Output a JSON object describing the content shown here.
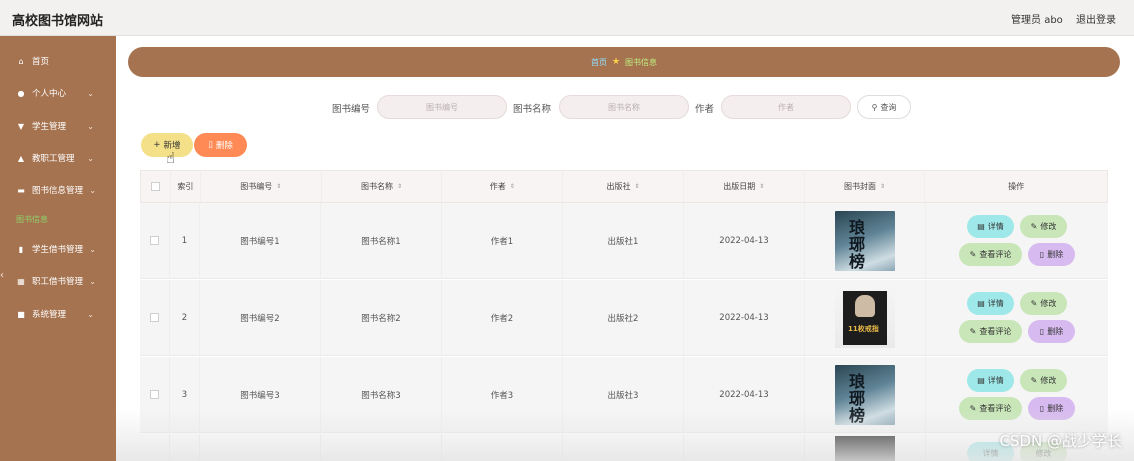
{
  "header": {
    "site_title": "高校图书馆网站",
    "admin_label": "管理员 abo",
    "logout_label": "退出登录"
  },
  "sidebar": {
    "items": [
      {
        "label": "首页",
        "icon": "home-icon"
      },
      {
        "label": "个人中心",
        "icon": "user-icon"
      },
      {
        "label": "学生管理",
        "icon": "student-icon"
      },
      {
        "label": "教职工管理",
        "icon": "staff-icon"
      },
      {
        "label": "图书信息管理",
        "icon": "book-icon"
      },
      {
        "label": "学生借书管理",
        "icon": "chart-icon"
      },
      {
        "label": "职工借书管理",
        "icon": "grid-icon"
      },
      {
        "label": "系统管理",
        "icon": "settings-icon"
      }
    ],
    "sub_item": "图书信息"
  },
  "breadcrumb": {
    "home": "首页",
    "current": "图书信息"
  },
  "search": {
    "book_no_label": "图书编号",
    "book_no_placeholder": "图书编号",
    "book_name_label": "图书名称",
    "book_name_placeholder": "图书名称",
    "author_label": "作者",
    "author_placeholder": "作者",
    "query_label": "查询"
  },
  "actions": {
    "add_label": "新增",
    "delete_label": "删除"
  },
  "table": {
    "headers": [
      "索引",
      "图书编号",
      "图书名称",
      "作者",
      "出版社",
      "出版日期",
      "图书封面",
      "操作"
    ],
    "rows": [
      {
        "index": "1",
        "book_no": "图书编号1",
        "book_name": "图书名称1",
        "author": "作者1",
        "publisher": "出版社1",
        "date": "2022-04-13"
      },
      {
        "index": "2",
        "book_no": "图书编号2",
        "book_name": "图书名称2",
        "author": "作者2",
        "publisher": "出版社2",
        "date": "2022-04-13"
      },
      {
        "index": "3",
        "book_no": "图书编号3",
        "book_name": "图书名称3",
        "author": "作者3",
        "publisher": "出版社3",
        "date": "2022-04-13"
      }
    ],
    "op_labels": {
      "detail": "详情",
      "edit": "修改",
      "comment": "查看评论",
      "delete": "删除"
    }
  },
  "cover_text": {
    "a": "琅琊榜",
    "b": "11枚戒指"
  },
  "watermark": "CSDN @战少学长",
  "colors": {
    "sidebar": "#a67350",
    "add": "#f3e089",
    "delete": "#ff8a55",
    "detail": "#9fe8ea",
    "edit": "#c8e6b8",
    "op_delete": "#d7baef"
  }
}
